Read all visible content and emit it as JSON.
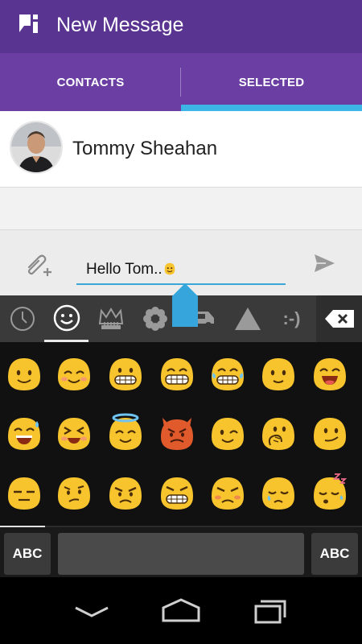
{
  "header": {
    "title": "New Message"
  },
  "tabs": [
    {
      "label": "CONTACTS"
    },
    {
      "label": "SELECTED"
    }
  ],
  "recipient": {
    "name": "Tommy Sheahan"
  },
  "compose": {
    "text": "Hello Tom.."
  },
  "keyboard": {
    "category_tabs": [
      "recent-icon",
      "smiley-icon",
      "crown-icon",
      "flower-icon",
      "car-icon",
      "triangle-icon",
      "emoticon-icon"
    ],
    "emoticon_text": ":-)",
    "left_key": "ABC",
    "right_key": "ABC"
  },
  "emojis": [
    "smiling-face",
    "smiling-blush",
    "grinning-face",
    "big-grin",
    "tears-of-joy",
    "slight-smile",
    "smile-open",
    "sweat-smile",
    "squinting-laugh",
    "halo-face",
    "devil-face",
    "winking-face",
    "nervous-face",
    "smirk-face",
    "expressionless-face",
    "confused-face",
    "angry-face",
    "grimacing-face",
    "pouting-face",
    "crying-face",
    "sleeping-face"
  ],
  "colors": {
    "appbar": "#593591",
    "tabs": "#6a3ea2",
    "accent": "#3cb6e6",
    "emoji": "#f7c42e"
  }
}
